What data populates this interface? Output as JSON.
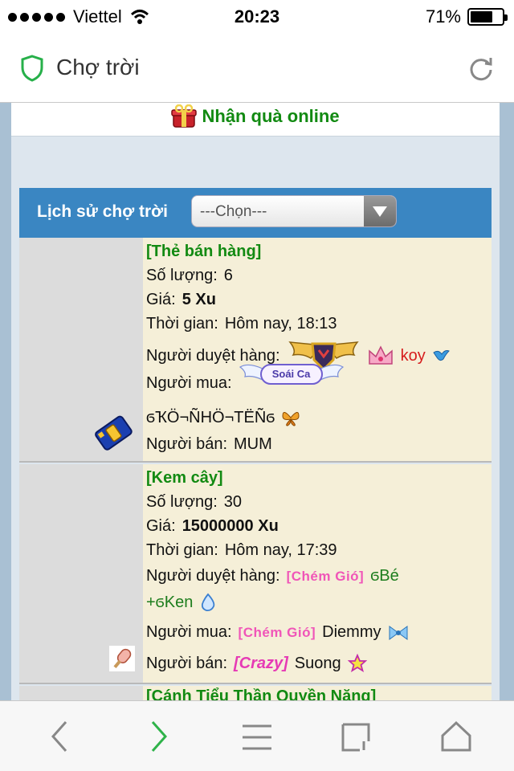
{
  "status_bar": {
    "carrier": "Viettel",
    "time": "20:23",
    "battery": "71%",
    "battery_level": 0.71
  },
  "browser": {
    "page_title": "Chợ trời"
  },
  "promo": {
    "text": "Nhận quà online"
  },
  "history": {
    "title": "Lịch sử chợ trời",
    "select_value": "---Chọn---"
  },
  "items": [
    {
      "name": "[Thẻ bán hàng]",
      "qty_label": "Số lượng:",
      "qty": "6",
      "price_label": "Giá:",
      "price": "5 Xu",
      "time_label": "Thời gian:",
      "time": "Hôm nay, 18:13",
      "approver_label": "Người duyệt hàng:",
      "approver": "koy",
      "buyer_label": "Người mua:",
      "buyer_badge": "Soái Ca",
      "buyer": "ϭҠÖ¬ÑHÖ¬TËÑϭ",
      "seller_label": "Người bán:",
      "seller": "MUM"
    },
    {
      "name": "[Kem cây]",
      "qty_label": "Số lượng:",
      "qty": "30",
      "price_label": "Giá:",
      "price": "15000000 Xu",
      "time_label": "Thời gian:",
      "time": "Hôm nay, 17:39",
      "approver_label": "Người duyệt hàng:",
      "approver_tag": "[Chém Gió]",
      "approver": "ϭBé",
      "approver_cont": "+ϭKen",
      "buyer_label": "Người mua:",
      "buyer_tag": "[Chém Gió]",
      "buyer": "Diemmy",
      "seller_label": "Người bán:",
      "seller_tag": "[Crazy]",
      "seller": "Suong"
    },
    {
      "name": "[Cánh Tiểu Thần Quyền Năng]"
    }
  ],
  "colors": {
    "item_name": "#128a12",
    "header_bg": "#3a86c2",
    "item_bg": "#f5efd8"
  },
  "icons": [
    "shield-icon",
    "reload-icon",
    "gift-icon",
    "card-icon",
    "icecream-icon",
    "back-icon",
    "forward-icon",
    "menu-icon",
    "tabs-icon",
    "home-icon"
  ]
}
